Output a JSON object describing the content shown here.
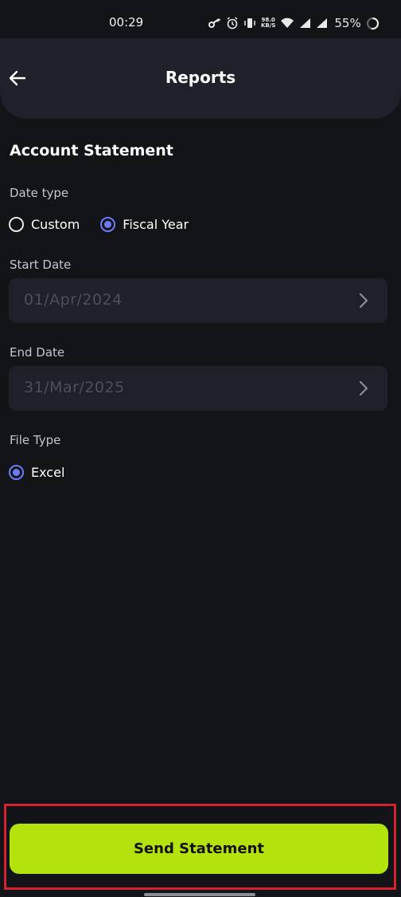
{
  "status_bar": {
    "time": "00:29",
    "net_speed_value": "98.0",
    "net_speed_unit": "KB/S",
    "battery": "55%",
    "icons": [
      "key-icon",
      "alarm-icon",
      "vibrate-icon",
      "wifi-icon",
      "signal-icon",
      "signal-icon-2",
      "battery-icon"
    ]
  },
  "header": {
    "title": "Reports",
    "back_icon": "back-arrow-icon"
  },
  "form": {
    "section_title": "Account Statement",
    "date_type": {
      "label": "Date type",
      "options": [
        "Custom",
        "Fiscal Year"
      ],
      "selected": "Fiscal Year"
    },
    "start_date": {
      "label": "Start Date",
      "value": "01/Apr/2024"
    },
    "end_date": {
      "label": "End Date",
      "value": "31/Mar/2025"
    },
    "file_type": {
      "label": "File Type",
      "options": [
        "Excel"
      ],
      "selected": "Excel"
    }
  },
  "actions": {
    "send_label": "Send Statement"
  },
  "colors": {
    "background": "#131418",
    "surface": "#1f2029",
    "accent": "#b3e20c",
    "radio_selected": "#6b7cf6",
    "highlight_border": "#d4212e"
  }
}
